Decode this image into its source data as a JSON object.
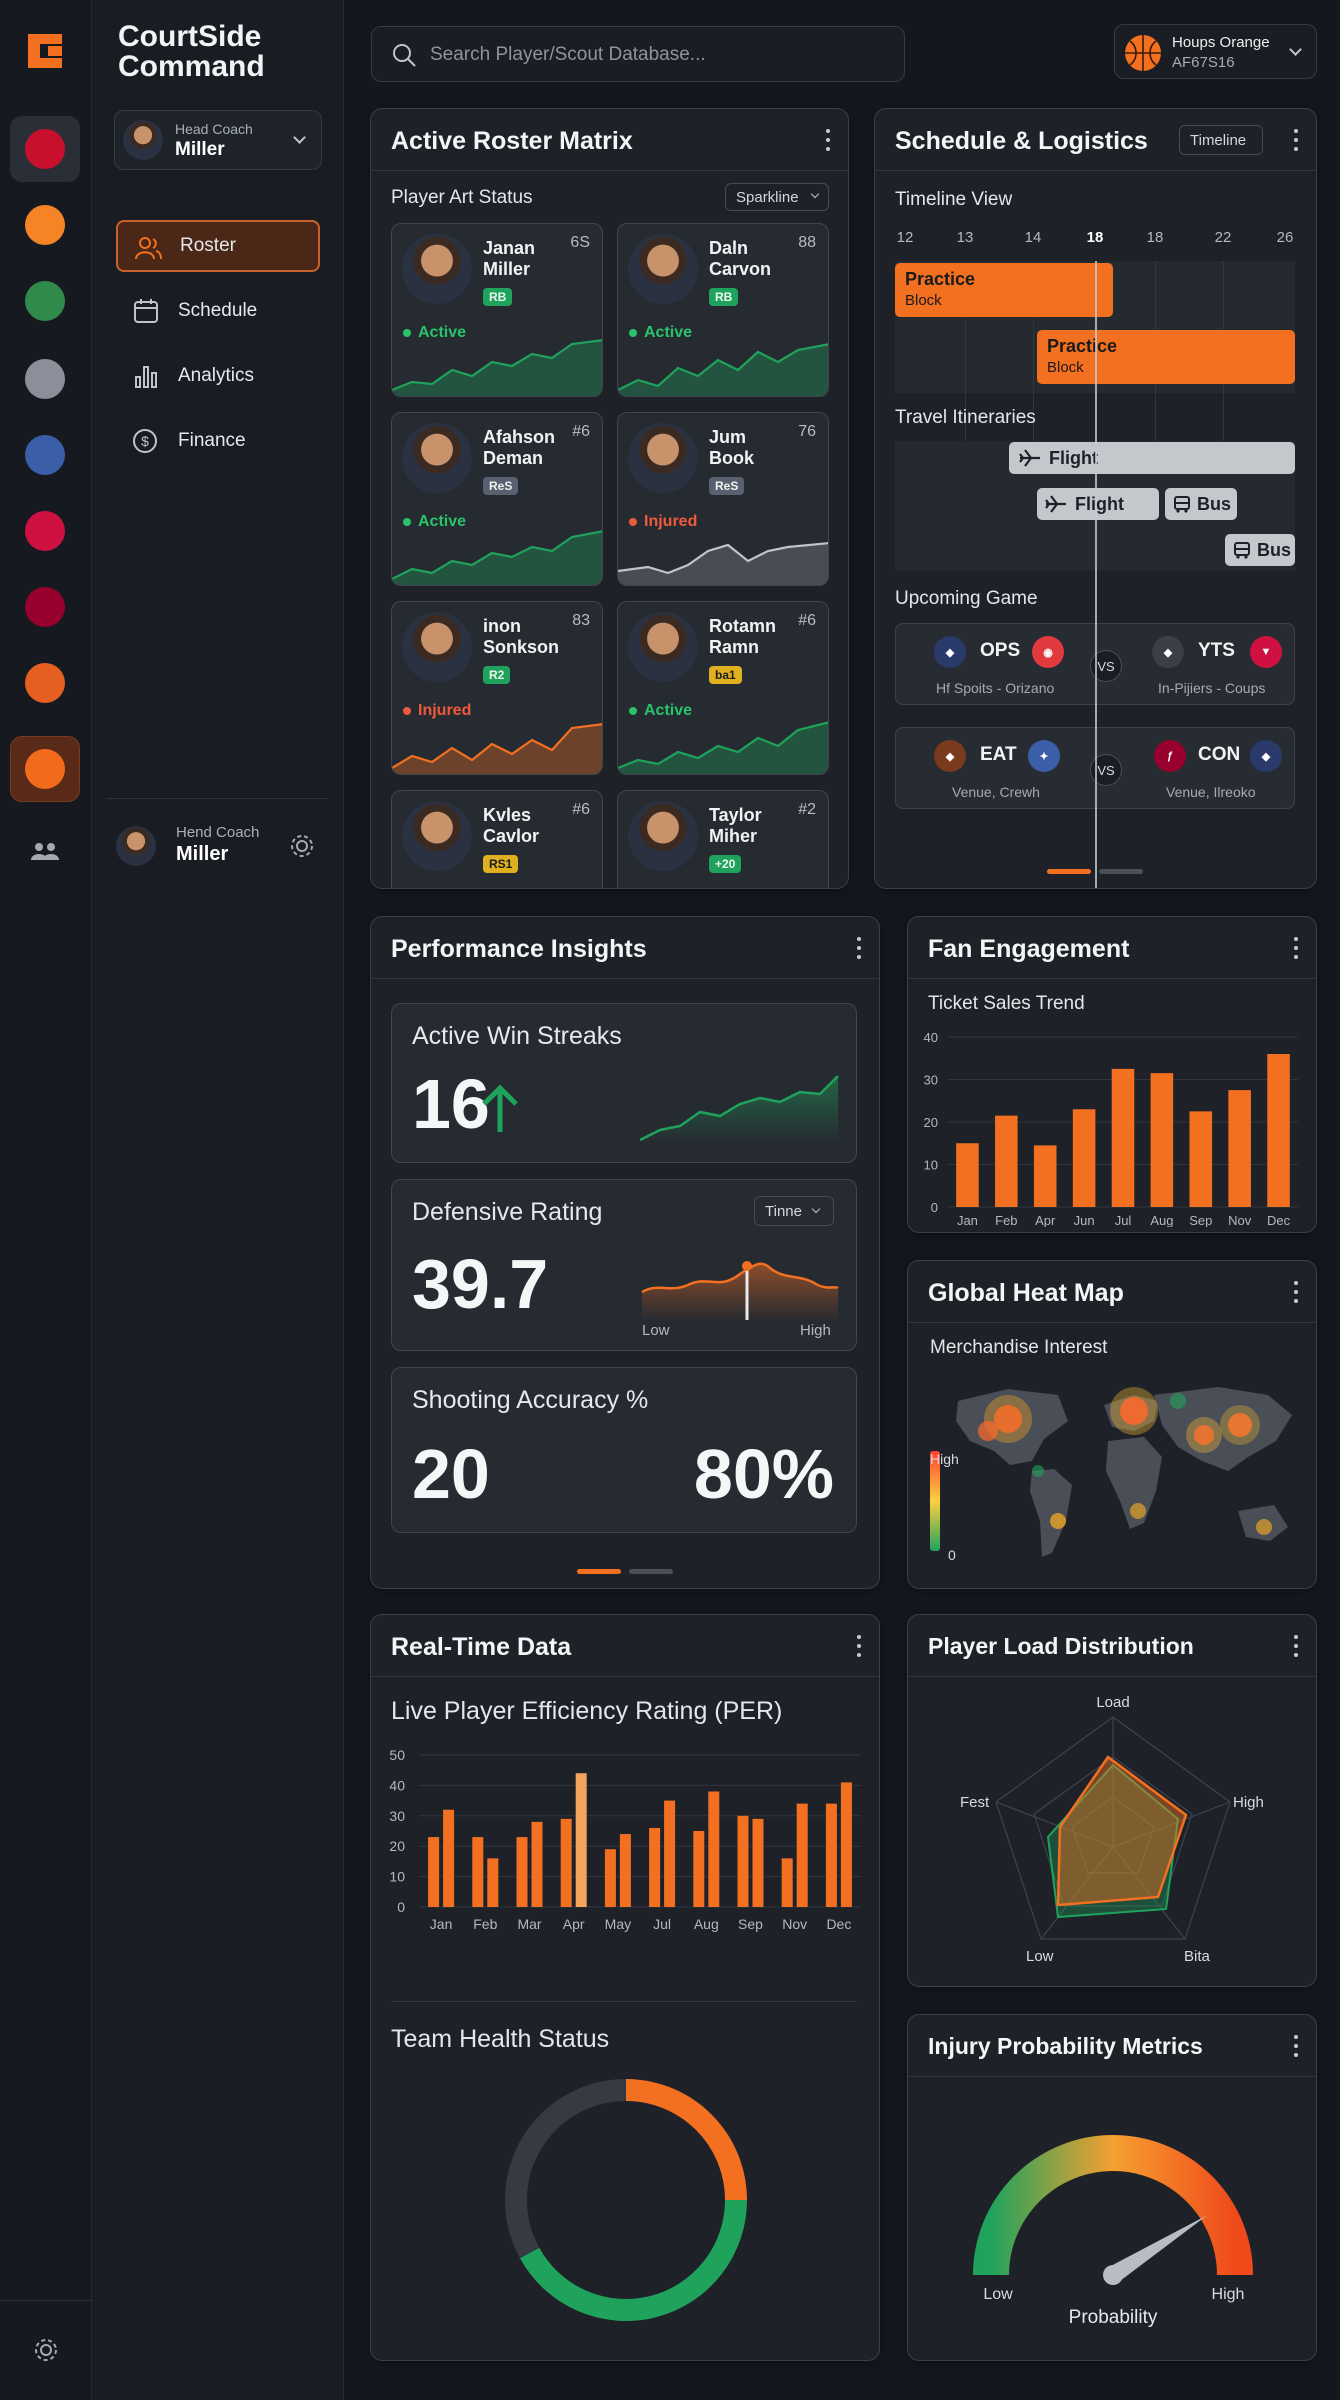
{
  "app": {
    "name_line1": "CourtSide",
    "name_line2": "Command"
  },
  "rail": {
    "teams": [
      {
        "icon": "team-logo-1-icon",
        "color": "#c8102e"
      },
      {
        "icon": "team-logo-knicks-icon",
        "color": "#f58426"
      },
      {
        "icon": "team-logo-2-icon",
        "color": "#2f8a4b"
      },
      {
        "icon": "team-logo-3-icon",
        "color": "#8a8f99"
      },
      {
        "icon": "team-logo-4-icon",
        "color": "#3b5ea8"
      },
      {
        "icon": "team-logo-bulls-icon",
        "color": "#ce1141"
      },
      {
        "icon": "team-logo-5-icon",
        "color": "#98002e"
      },
      {
        "icon": "team-logo-suns-icon",
        "color": "#e56020"
      },
      {
        "icon": "basketball-icon",
        "color": "#f26a1b"
      },
      {
        "icon": "people-icon",
        "color": "#a4a9b2"
      }
    ]
  },
  "coach": {
    "role": "Head Coach",
    "name": "Miller"
  },
  "coach_bottom": {
    "role": "Hend Coach",
    "name": "Miller"
  },
  "nav": {
    "roster": "Roster",
    "schedule": "Schedule",
    "analytics": "Analytics",
    "finance": "Finance"
  },
  "search": {
    "placeholder": "Search Player/Scout Database..."
  },
  "user": {
    "name": "Houps Orange",
    "code": "AF67S16"
  },
  "roster": {
    "title": "Active Roster Matrix",
    "sub": "Player Art Status",
    "dropdown": "Sparkline",
    "players": [
      {
        "name1": "Janan",
        "name2": "Miller",
        "no": "6S",
        "badge": "RB",
        "badge_color": "#1fa35c",
        "status": "Active",
        "status_color": "#29c36a"
      },
      {
        "name1": "Daln",
        "name2": "Carvon",
        "no": "88",
        "badge": "RB",
        "badge_color": "#1fa35c",
        "status": "Active",
        "status_color": "#29c36a"
      },
      {
        "name1": "Afahson",
        "name2": "Deman",
        "no": "#6",
        "badge": "ReS",
        "badge_color": "#5a6070",
        "status": "Active",
        "status_color": "#29c36a"
      },
      {
        "name1": "Jum",
        "name2": "Book",
        "no": "76",
        "badge": "ReS",
        "badge_color": "#5a6070",
        "status": "Injured",
        "status_color": "#f05a3c"
      },
      {
        "name1": "inon",
        "name2": "Sonkson",
        "no": "83",
        "badge": "R2",
        "badge_color": "#1fa35c",
        "status": "Injured",
        "status_color": "#f05a3c"
      },
      {
        "name1": "Rotamn",
        "name2": "Ramn",
        "no": "#6",
        "badge": "ba1",
        "badge_color": "#e0b020",
        "status": "Active",
        "status_color": "#29c36a"
      },
      {
        "name1": "Kvles",
        "name2": "Cavlor",
        "no": "#6",
        "badge": "RS1",
        "badge_color": "#e0b020",
        "status": "",
        "status_color": "#29c36a"
      },
      {
        "name1": "Taylor",
        "name2": "Miher",
        "no": "#2",
        "badge": "+20",
        "badge_color": "#1fa35c",
        "status": "",
        "status_color": "#29c36a"
      }
    ]
  },
  "schedule": {
    "title": "Schedule & Logistics",
    "toggle": "Timeline",
    "timeline_label": "Timeline View",
    "ticks": [
      "12",
      "13",
      "14",
      "18",
      "18",
      "22",
      "26"
    ],
    "bar1": {
      "a": "Practice",
      "b": "Block"
    },
    "bar2": {
      "a": "Practice",
      "b": "Block"
    },
    "travel_label": "Travel Itineraries",
    "travel": [
      "Flight",
      "Flight",
      "Bus",
      "Bus"
    ],
    "upcoming_label": "Upcoming Game",
    "games": [
      {
        "home": "OPS",
        "away": "YTS",
        "home_sub": "Hf Spoits - Orizano",
        "away_sub": "In-Pijiers - Coups",
        "vs": "VS"
      },
      {
        "home": "EAT",
        "away": "CON",
        "home_sub": "Venue, Crewh",
        "away_sub": "Venue, Ilreoko",
        "vs": "VS"
      }
    ]
  },
  "performance": {
    "title": "Performance Insights",
    "streak_label": "Active Win Streaks",
    "streak_value": "16",
    "def_label": "Defensive Rating",
    "def_value": "39.7",
    "def_dropdown": "Tinne",
    "def_low": "Low",
    "def_high": "High",
    "shoot_label": "Shooting Accuracy %",
    "shoot_value": "20",
    "shoot_pct": "80%"
  },
  "fan": {
    "title": "Fan Engagement",
    "sub": "Ticket Sales Trend",
    "chart_data": {
      "type": "bar",
      "categories": [
        "Jan",
        "Feb",
        "Apr",
        "Jun",
        "Jul",
        "Aug",
        "Sep",
        "Nov",
        "Dec"
      ],
      "values": [
        15,
        21.5,
        14.5,
        23,
        32.5,
        31.5,
        22.5,
        27.5,
        36
      ],
      "ylim": [
        0,
        40
      ],
      "yticks": [
        0,
        10,
        20,
        30,
        40
      ],
      "color": "#f37021"
    }
  },
  "heatmap": {
    "title": "Global Heat Map",
    "sub": "Merchandise Interest",
    "high": "High",
    "zero": "0"
  },
  "realtime": {
    "title": "Real-Time Data",
    "sub": "Live Player Efficiency Rating (PER)",
    "chart_data": {
      "type": "bar",
      "categories": [
        "Jan",
        "Feb",
        "Mar",
        "Apr",
        "May",
        "Jul",
        "Aug",
        "Sep",
        "Nov",
        "Dec"
      ],
      "series": [
        {
          "values": [
            23,
            23,
            23,
            29,
            19,
            26,
            25,
            30,
            16,
            34
          ]
        },
        {
          "values": [
            32,
            16,
            28,
            44,
            24,
            35,
            38,
            29,
            34,
            41
          ]
        }
      ],
      "highlight_index": 3,
      "ylim": [
        0,
        50
      ],
      "yticks": [
        0,
        10,
        20,
        30,
        40,
        50
      ],
      "color": "#f37021",
      "highlight_color": "#f5a55a"
    },
    "health_label": "Team Health Status",
    "health_chart": {
      "type": "pie",
      "segments": [
        {
          "value": 25,
          "color": "#f37021"
        },
        {
          "value": 42,
          "color": "#1fa35c"
        },
        {
          "value": 33,
          "color": "#353a43"
        }
      ]
    }
  },
  "load": {
    "title": "Player Load Distribution",
    "axes": [
      "Load",
      "High",
      "Bita",
      "Low",
      "Fest"
    ]
  },
  "injury": {
    "title": "Injury Probability Metrics",
    "low": "Low",
    "high": "High",
    "caption": "Probability",
    "gauge_level": 0.82
  }
}
